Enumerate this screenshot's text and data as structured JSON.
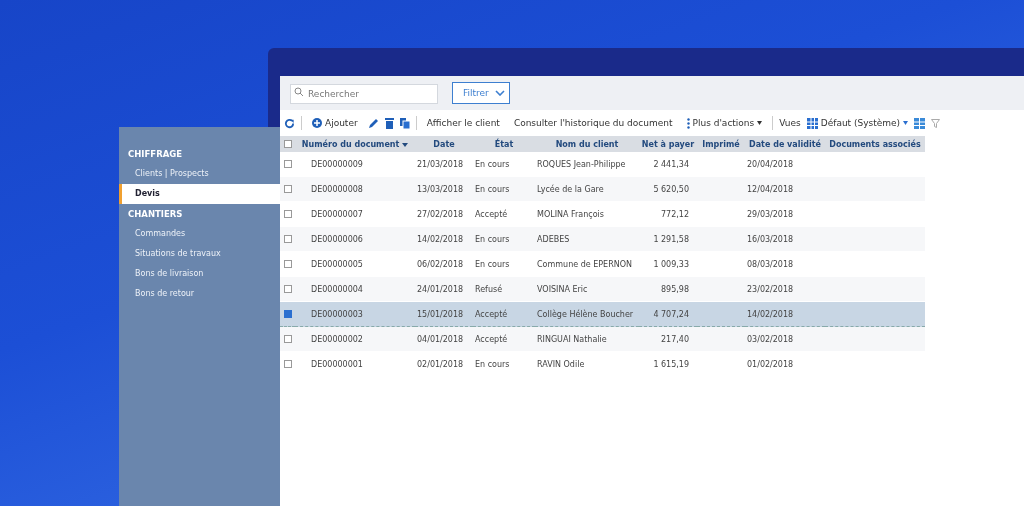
{
  "sidebar": {
    "sections": [
      {
        "title": "CHIFFRAGE",
        "items": [
          {
            "label": "Clients | Prospects",
            "selected": false
          },
          {
            "label": "Devis",
            "selected": true
          }
        ]
      },
      {
        "title": "CHANTIERS",
        "items": [
          {
            "label": "Commandes",
            "selected": false
          },
          {
            "label": "Situations de travaux",
            "selected": false
          },
          {
            "label": "Bons de livraison",
            "selected": false
          },
          {
            "label": "Bons de retour",
            "selected": false
          }
        ]
      }
    ]
  },
  "search": {
    "placeholder": "Rechercher"
  },
  "filter_button": "Filtrer",
  "toolbar": {
    "add": "Ajouter",
    "actions": [
      "Afficher le client",
      "Consulter l'historique du document"
    ],
    "more": "Plus d'actions",
    "views_label": "Vues",
    "view": "Défaut (Système)"
  },
  "table": {
    "all_selected": false,
    "columns": [
      "Numéro du document",
      "Date",
      "État",
      "Nom du client",
      "Net à payer",
      "Imprimé",
      "Date de validité",
      "Documents associés"
    ],
    "rows": [
      {
        "selected": false,
        "cells": [
          "DE00000009",
          "21/03/2018",
          "En cours",
          "ROQUES Jean-Philippe",
          "2 441,34",
          "",
          "20/04/2018",
          ""
        ]
      },
      {
        "selected": false,
        "cells": [
          "DE00000008",
          "13/03/2018",
          "En cours",
          "Lycée de la Gare",
          "5 620,50",
          "",
          "12/04/2018",
          ""
        ]
      },
      {
        "selected": false,
        "cells": [
          "DE00000007",
          "27/02/2018",
          "Accepté",
          "MOLINA François",
          "772,12",
          "",
          "29/03/2018",
          ""
        ]
      },
      {
        "selected": false,
        "cells": [
          "DE00000006",
          "14/02/2018",
          "En cours",
          "ADEBES",
          "1 291,58",
          "",
          "16/03/2018",
          ""
        ]
      },
      {
        "selected": false,
        "cells": [
          "DE00000005",
          "06/02/2018",
          "En cours",
          "Commune de EPERNON",
          "1 009,33",
          "",
          "08/03/2018",
          ""
        ]
      },
      {
        "selected": false,
        "cells": [
          "DE00000004",
          "24/01/2018",
          "Refusé",
          "VOISINA Eric",
          "895,98",
          "",
          "23/02/2018",
          ""
        ]
      },
      {
        "selected": true,
        "cells": [
          "DE00000003",
          "15/01/2018",
          "Accepté",
          "Collège Hélène Boucher",
          "4 707,24",
          "",
          "14/02/2018",
          ""
        ]
      },
      {
        "selected": false,
        "cells": [
          "DE00000002",
          "04/01/2018",
          "Accepté",
          "RINGUAI Nathalie",
          "217,40",
          "",
          "03/02/2018",
          ""
        ]
      },
      {
        "selected": false,
        "cells": [
          "DE00000001",
          "02/01/2018",
          "En cours",
          "RAVIN Odile",
          "1 615,19",
          "",
          "01/02/2018",
          ""
        ]
      }
    ]
  }
}
